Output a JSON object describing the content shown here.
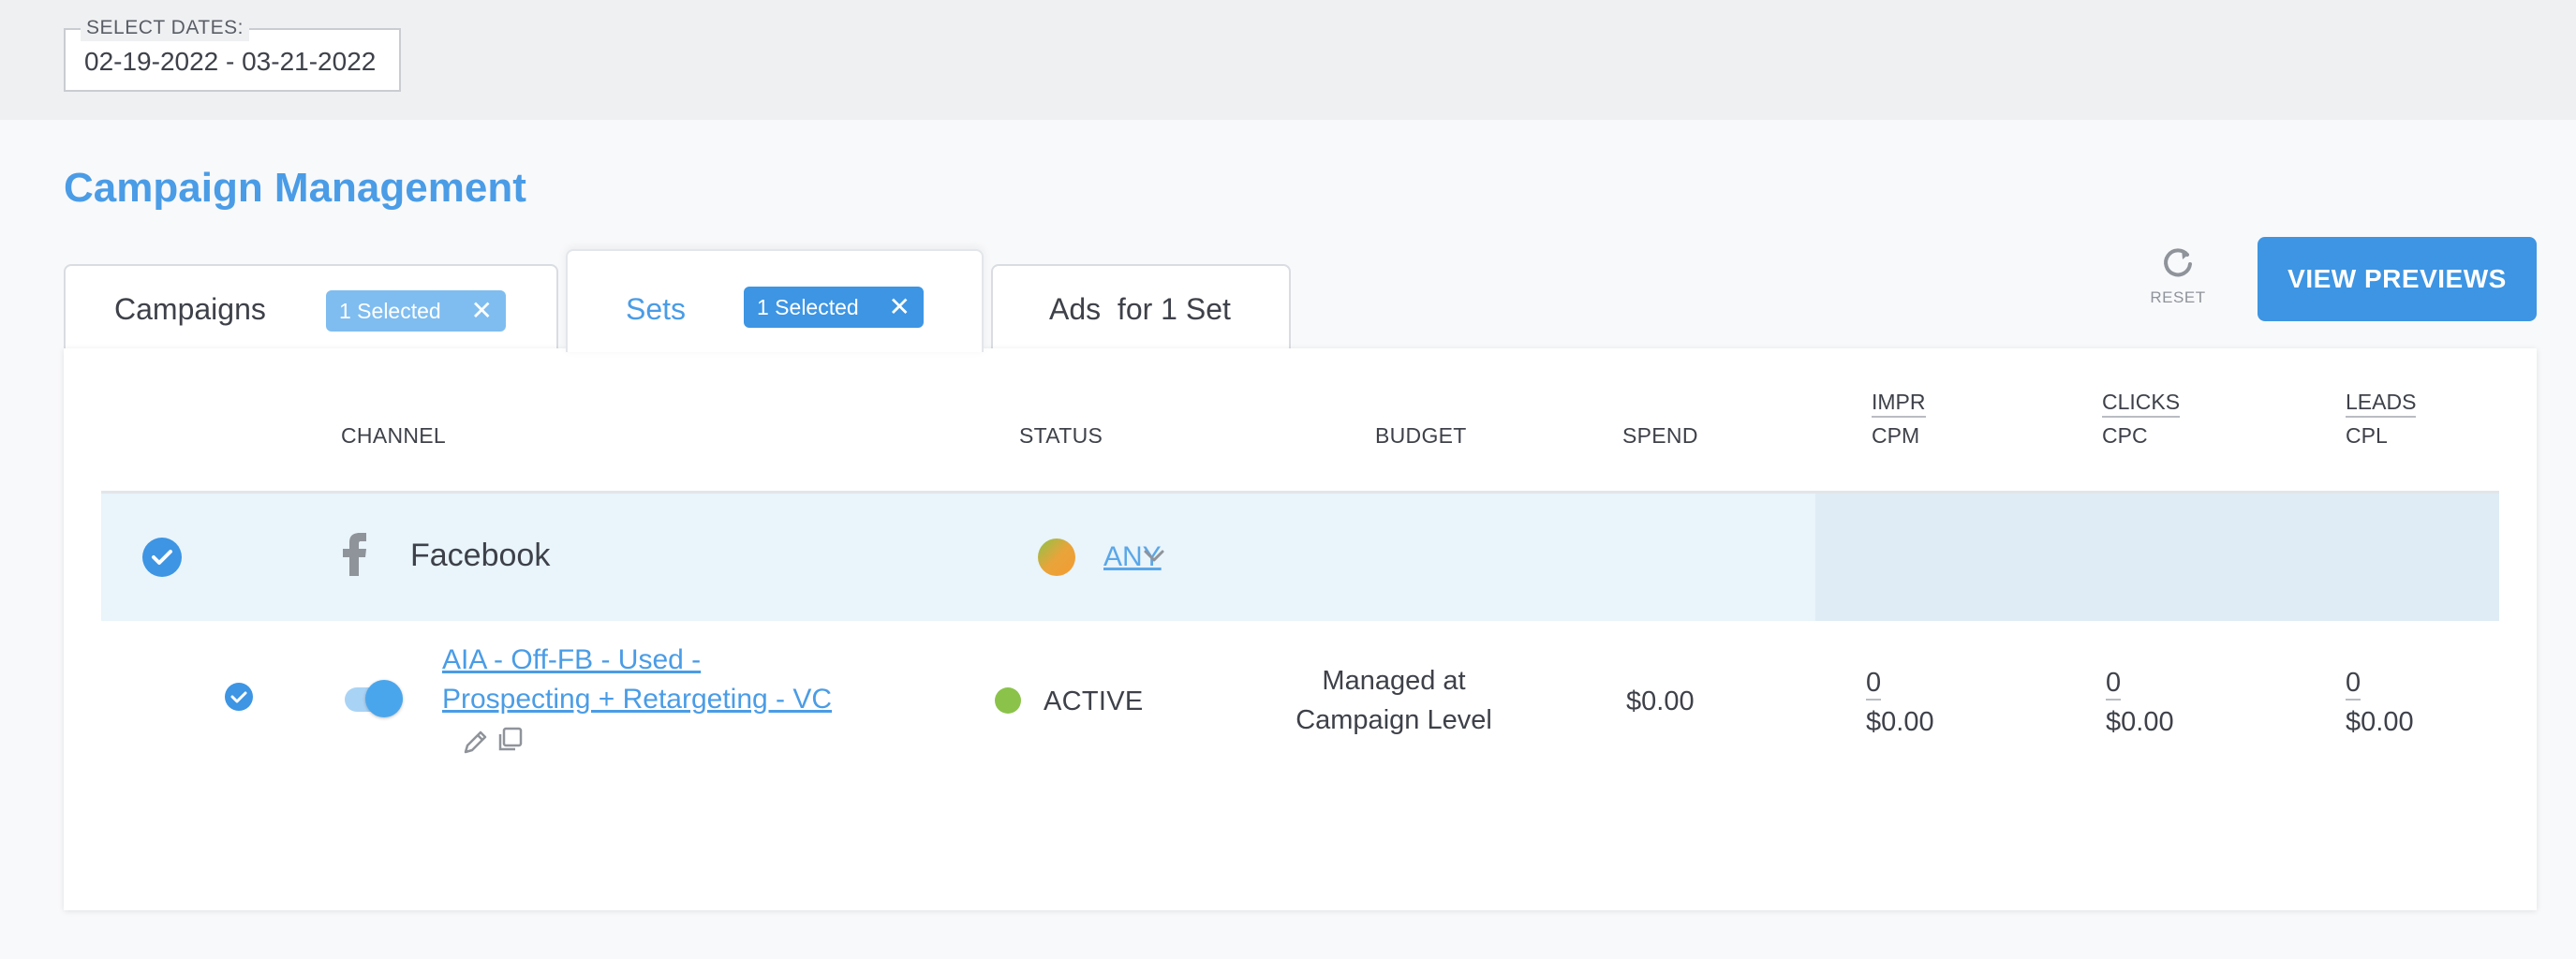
{
  "date_filter": {
    "label": "SELECT DATES:",
    "value": "02-19-2022 - 03-21-2022"
  },
  "page_title": "Campaign Management",
  "tabs": [
    {
      "label": "Campaigns",
      "chip": "1 Selected",
      "chip_close": "✕"
    },
    {
      "label": "Sets",
      "chip": "1 Selected",
      "chip_close": "✕",
      "active": true
    },
    {
      "label": "Ads  for 1 Set"
    }
  ],
  "toolbar": {
    "reset_label": "RESET",
    "view_previews_label": "VIEW PREVIEWS"
  },
  "table": {
    "headers": {
      "channel": "CHANNEL",
      "status": "STATUS",
      "budget": "BUDGET",
      "spend": "SPEND",
      "impr": "IMPR",
      "cpm": "CPM",
      "clicks": "CLICKS",
      "cpc": "CPC",
      "leads": "LEADS",
      "cpl": "CPL"
    },
    "channel_row": {
      "name": "Facebook",
      "status_filter": "ANY",
      "icon": "facebook-icon"
    },
    "rows": [
      {
        "name_line1": "AIA - Off-FB - Used -",
        "name_line2": "Prospecting + Retargeting - VC",
        "status": "ACTIVE",
        "budget_line1": "Managed at",
        "budget_line2": "Campaign Level",
        "spend": "$0.00",
        "impr": "0",
        "cpm": "$0.00",
        "clicks": "0",
        "cpc": "$0.00",
        "leads": "0",
        "cpl": "$0.00",
        "toggle_on": true
      }
    ]
  },
  "colors": {
    "accent": "#4a9ce6",
    "button": "#3d95e3",
    "active_status": "#8bc34a",
    "channel_row_bg": "#e9f4fb"
  }
}
